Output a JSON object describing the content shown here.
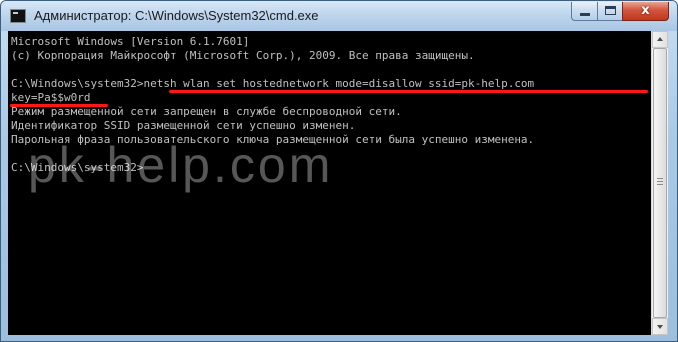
{
  "window": {
    "title": "Администратор: C:\\Windows\\System32\\cmd.exe",
    "close_glyph": "x"
  },
  "icons": {
    "app": "console-icon",
    "minimize": "minimize-icon",
    "maximize": "maximize-icon",
    "close": "close-icon"
  },
  "console": {
    "lines": [
      "Microsoft Windows [Version 6.1.7601]",
      "(c) Корпорация Майкрософт (Microsoft Corp.), 2009. Все права защищены.",
      "",
      "C:\\Windows\\system32>netsh wlan set hostednetwork mode=disallow ssid=pk-help.com",
      "key=Pa$$w0rd",
      "Режим размещенной сети запрещен в службе беспроводной сети.",
      "Идентификатор SSID размещенной сети успешно изменен.",
      "Парольная фраза пользовательского ключа размещенной сети была успешно изменена.",
      "",
      "",
      "C:\\Windows\\system32>"
    ]
  },
  "watermark": "pk-help.com",
  "colors": {
    "console_bg": "#000000",
    "console_text": "#c0c0c0",
    "highlight": "#ff1616"
  }
}
